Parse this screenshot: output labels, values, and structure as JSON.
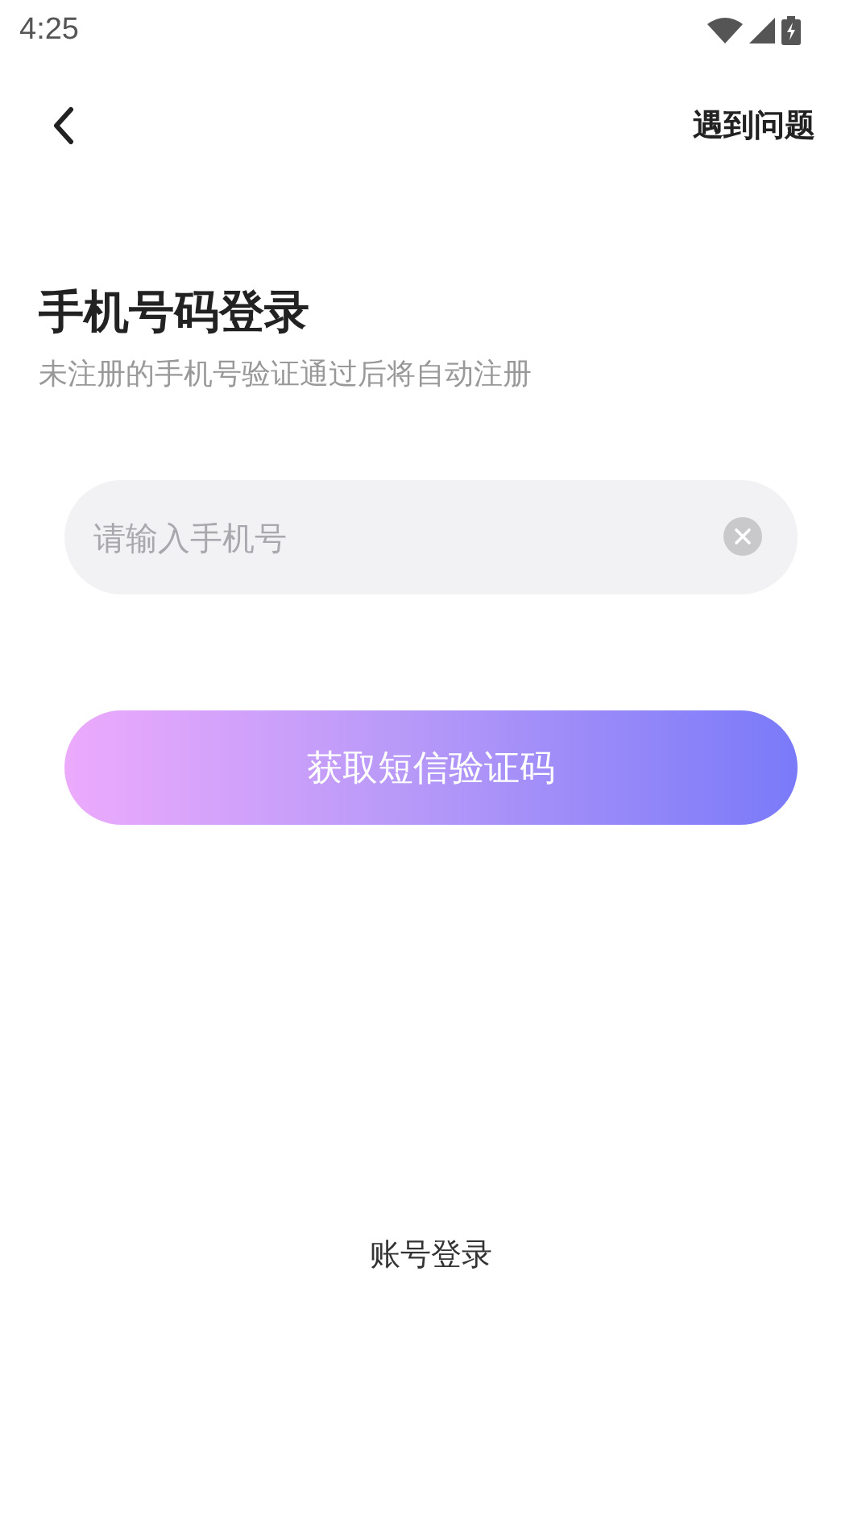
{
  "status_bar": {
    "time": "4:25"
  },
  "nav": {
    "help_link": "遇到问题"
  },
  "title": "手机号码登录",
  "subtitle": "未注册的手机号验证通过后将自动注册",
  "phone_field": {
    "placeholder": "请输入手机号"
  },
  "submit_button": "获取短信验证码",
  "alt_login_link": "账号登录"
}
